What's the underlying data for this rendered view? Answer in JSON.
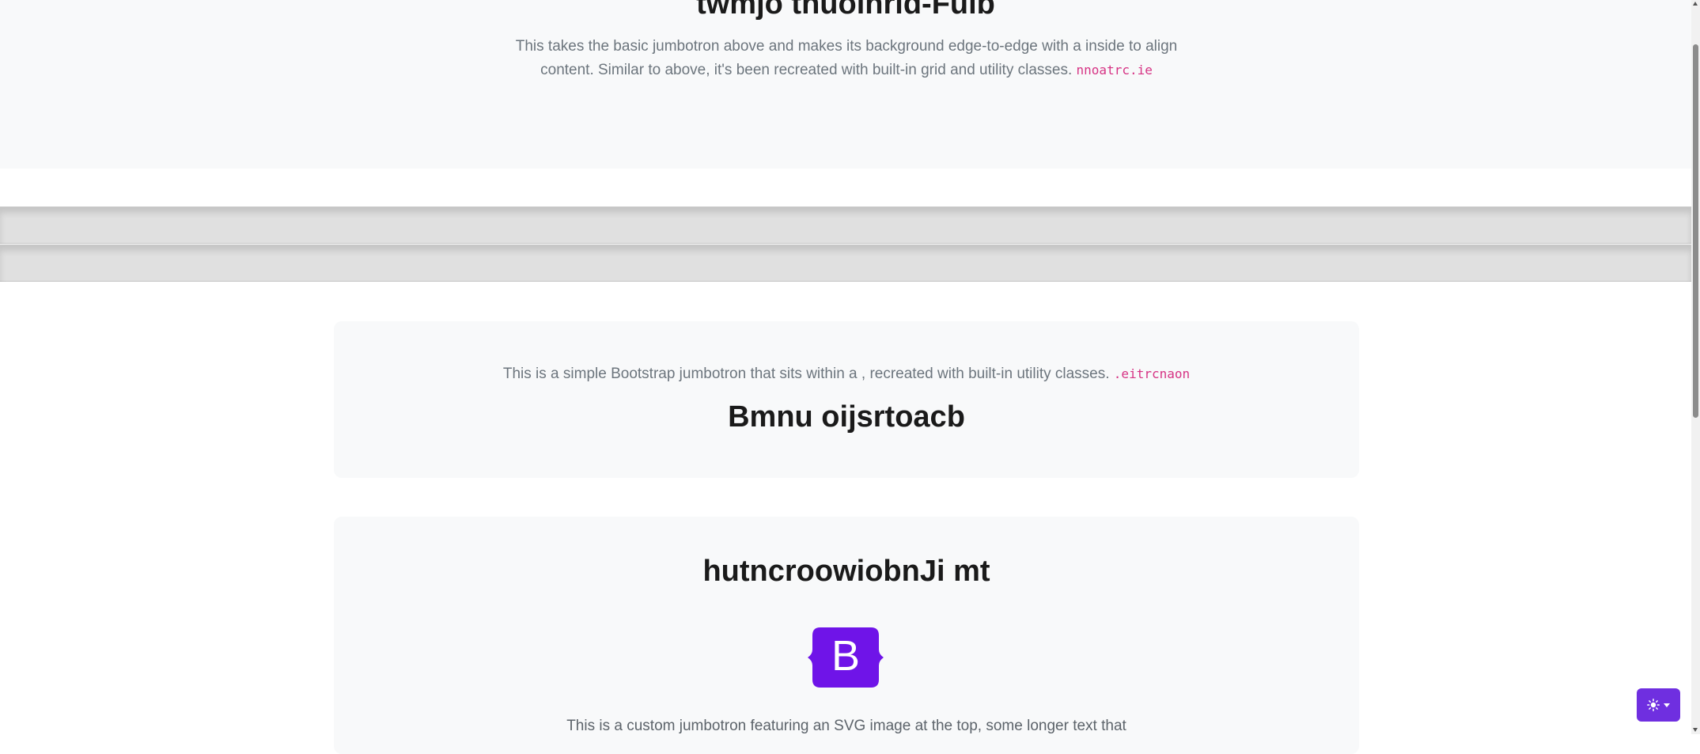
{
  "hero": {
    "title": "twmjo thuoinrld-Fulb",
    "lead": "This takes the basic jumbotron above and makes its background edge-to-edge with a inside to align content. Similar to above, it's been recreated with built-in grid and utility classes. ",
    "code": "nnoatrc.ie"
  },
  "card1": {
    "text": "This is a simple Bootstrap jumbotron that sits within a , recreated with built-in utility classes. ",
    "code": ".eitrcnaon",
    "title": "Bmnu oijsrtoacb"
  },
  "card2": {
    "title": "hutncroowiobnJi mt",
    "logo_letter": "B",
    "logo_icon": "bootstrap-logo",
    "text": "This is a custom jumbotron featuring an SVG image at the top, some longer text that"
  },
  "theme_toggle": {
    "icon": "sun-icon",
    "caret": "caret-down-icon"
  },
  "colors": {
    "accent": "#6f2fe0",
    "code": "#d63384",
    "panel_bg": "#f8f9fa",
    "divider": "#e0e0e0"
  }
}
